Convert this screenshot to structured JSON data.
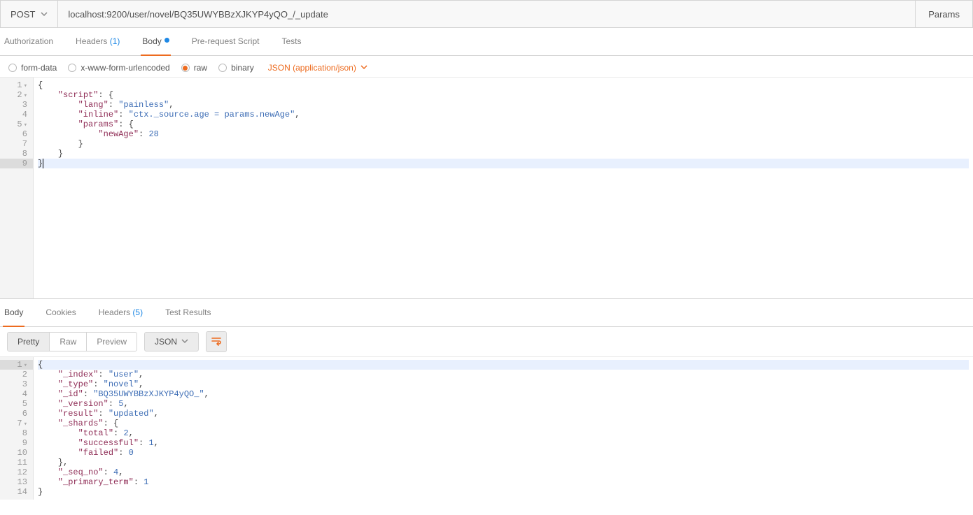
{
  "topbar": {
    "method": "POST",
    "url": "localhost:9200/user/novel/BQ35UWYBBzXJKYP4yQO_/_update",
    "params_label": "Params"
  },
  "tabs": {
    "auth": "Authorization",
    "headers": "Headers",
    "headers_count": "(1)",
    "body": "Body",
    "prescript": "Pre-request Script",
    "tests": "Tests"
  },
  "bodytype": {
    "formdata": "form-data",
    "urlenc": "x-www-form-urlencoded",
    "raw": "raw",
    "binary": "binary",
    "ctype": "JSON (application/json)"
  },
  "editor_req": {
    "gutter_fold": [
      "1",
      "2",
      "3",
      "4",
      "5",
      "6",
      "7",
      "8",
      "9"
    ],
    "fold_rows": [
      1,
      2,
      5
    ],
    "lines": [
      [
        {
          "t": "brace",
          "v": "{"
        }
      ],
      [
        {
          "t": "sp",
          "v": "    "
        },
        {
          "t": "key",
          "v": "\"script\""
        },
        {
          "t": "punc",
          "v": ": "
        },
        {
          "t": "brace",
          "v": "{"
        }
      ],
      [
        {
          "t": "sp",
          "v": "        "
        },
        {
          "t": "key",
          "v": "\"lang\""
        },
        {
          "t": "punc",
          "v": ": "
        },
        {
          "t": "str",
          "v": "\"painless\""
        },
        {
          "t": "punc",
          "v": ","
        }
      ],
      [
        {
          "t": "sp",
          "v": "        "
        },
        {
          "t": "key",
          "v": "\"inline\""
        },
        {
          "t": "punc",
          "v": ": "
        },
        {
          "t": "str",
          "v": "\"ctx._source.age = params.newAge\""
        },
        {
          "t": "punc",
          "v": ","
        }
      ],
      [
        {
          "t": "sp",
          "v": "        "
        },
        {
          "t": "key",
          "v": "\"params\""
        },
        {
          "t": "punc",
          "v": ": "
        },
        {
          "t": "brace",
          "v": "{"
        }
      ],
      [
        {
          "t": "sp",
          "v": "            "
        },
        {
          "t": "key",
          "v": "\"newAge\""
        },
        {
          "t": "punc",
          "v": ": "
        },
        {
          "t": "num",
          "v": "28"
        }
      ],
      [
        {
          "t": "sp",
          "v": "        "
        },
        {
          "t": "brace",
          "v": "}"
        }
      ],
      [
        {
          "t": "sp",
          "v": "    "
        },
        {
          "t": "brace",
          "v": "}"
        }
      ],
      [
        {
          "t": "brace",
          "v": "}"
        }
      ]
    ],
    "hl_row": 9,
    "pad_rows": 13
  },
  "resp_tabs": {
    "body": "Body",
    "cookies": "Cookies",
    "headers": "Headers",
    "headers_count": "(5)",
    "tests": "Test Results"
  },
  "resp_toolbar": {
    "pretty": "Pretty",
    "raw": "Raw",
    "preview": "Preview",
    "format": "JSON"
  },
  "editor_resp": {
    "gutter_fold": [
      "1",
      "2",
      "3",
      "4",
      "5",
      "6",
      "7",
      "8",
      "9",
      "10",
      "11",
      "12",
      "13",
      "14"
    ],
    "fold_rows": [
      1,
      7
    ],
    "hl_row": 1,
    "lines": [
      [
        {
          "t": "brace",
          "v": "{"
        }
      ],
      [
        {
          "t": "sp",
          "v": "    "
        },
        {
          "t": "key",
          "v": "\"_index\""
        },
        {
          "t": "punc",
          "v": ": "
        },
        {
          "t": "str",
          "v": "\"user\""
        },
        {
          "t": "punc",
          "v": ","
        }
      ],
      [
        {
          "t": "sp",
          "v": "    "
        },
        {
          "t": "key",
          "v": "\"_type\""
        },
        {
          "t": "punc",
          "v": ": "
        },
        {
          "t": "str",
          "v": "\"novel\""
        },
        {
          "t": "punc",
          "v": ","
        }
      ],
      [
        {
          "t": "sp",
          "v": "    "
        },
        {
          "t": "key",
          "v": "\"_id\""
        },
        {
          "t": "punc",
          "v": ": "
        },
        {
          "t": "str",
          "v": "\"BQ35UWYBBzXJKYP4yQO_\""
        },
        {
          "t": "punc",
          "v": ","
        }
      ],
      [
        {
          "t": "sp",
          "v": "    "
        },
        {
          "t": "key",
          "v": "\"_version\""
        },
        {
          "t": "punc",
          "v": ": "
        },
        {
          "t": "num",
          "v": "5"
        },
        {
          "t": "punc",
          "v": ","
        }
      ],
      [
        {
          "t": "sp",
          "v": "    "
        },
        {
          "t": "key",
          "v": "\"result\""
        },
        {
          "t": "punc",
          "v": ": "
        },
        {
          "t": "str",
          "v": "\"updated\""
        },
        {
          "t": "punc",
          "v": ","
        }
      ],
      [
        {
          "t": "sp",
          "v": "    "
        },
        {
          "t": "key",
          "v": "\"_shards\""
        },
        {
          "t": "punc",
          "v": ": "
        },
        {
          "t": "brace",
          "v": "{"
        }
      ],
      [
        {
          "t": "sp",
          "v": "        "
        },
        {
          "t": "key",
          "v": "\"total\""
        },
        {
          "t": "punc",
          "v": ": "
        },
        {
          "t": "num",
          "v": "2"
        },
        {
          "t": "punc",
          "v": ","
        }
      ],
      [
        {
          "t": "sp",
          "v": "        "
        },
        {
          "t": "key",
          "v": "\"successful\""
        },
        {
          "t": "punc",
          "v": ": "
        },
        {
          "t": "num",
          "v": "1"
        },
        {
          "t": "punc",
          "v": ","
        }
      ],
      [
        {
          "t": "sp",
          "v": "        "
        },
        {
          "t": "key",
          "v": "\"failed\""
        },
        {
          "t": "punc",
          "v": ": "
        },
        {
          "t": "num",
          "v": "0"
        }
      ],
      [
        {
          "t": "sp",
          "v": "    "
        },
        {
          "t": "brace",
          "v": "}"
        },
        {
          "t": "punc",
          "v": ","
        }
      ],
      [
        {
          "t": "sp",
          "v": "    "
        },
        {
          "t": "key",
          "v": "\"_seq_no\""
        },
        {
          "t": "punc",
          "v": ": "
        },
        {
          "t": "num",
          "v": "4"
        },
        {
          "t": "punc",
          "v": ","
        }
      ],
      [
        {
          "t": "sp",
          "v": "    "
        },
        {
          "t": "key",
          "v": "\"_primary_term\""
        },
        {
          "t": "punc",
          "v": ": "
        },
        {
          "t": "num",
          "v": "1"
        }
      ],
      [
        {
          "t": "brace",
          "v": "}"
        }
      ]
    ]
  }
}
